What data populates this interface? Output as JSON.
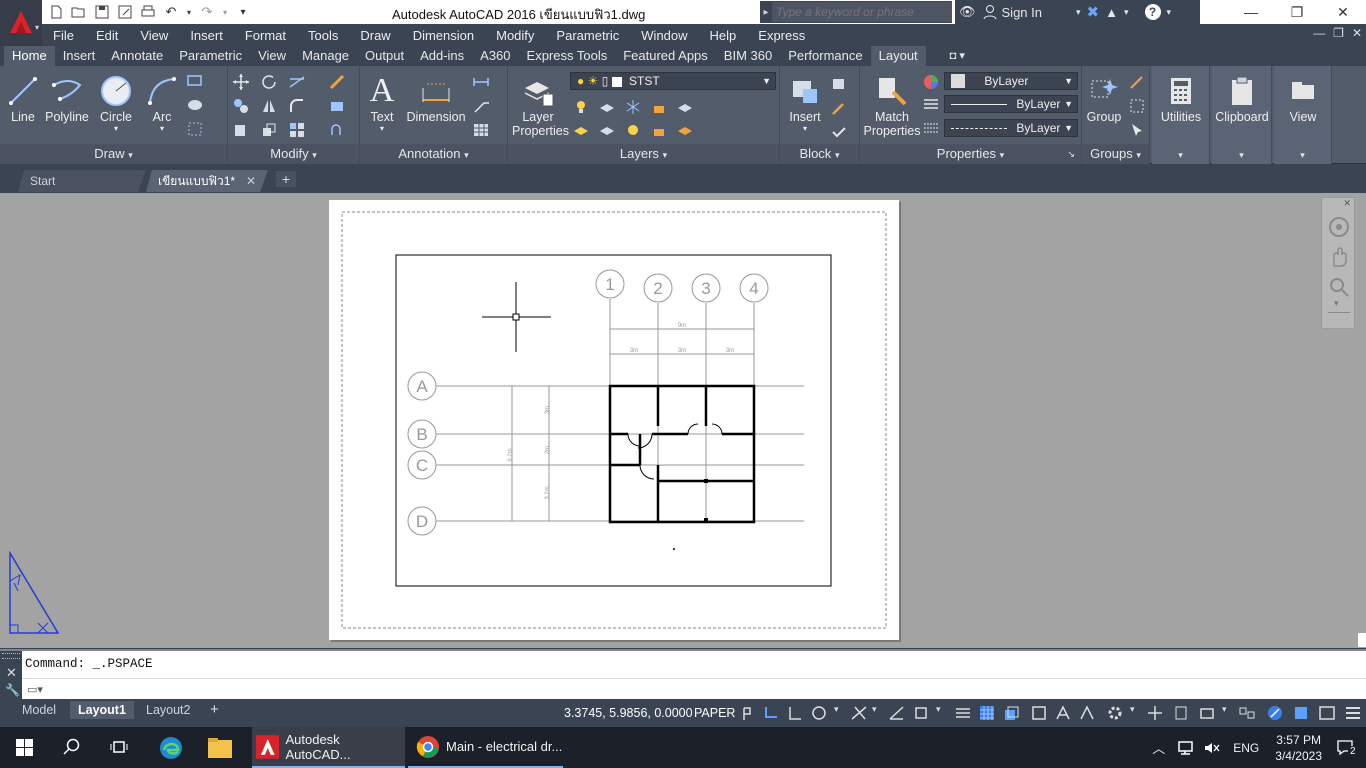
{
  "titlebar": {
    "app_title": "Autodesk AutoCAD 2016    เขียนแบบฟิว1.dwg",
    "search_placeholder": "Type a keyword or phrase",
    "signin_label": "Sign In",
    "qat_icons": [
      "new-icon",
      "open-icon",
      "save-icon",
      "saveas-icon",
      "plot-icon",
      "undo-icon",
      "redo-icon",
      "customize-icon"
    ]
  },
  "menu": [
    "File",
    "Edit",
    "View",
    "Insert",
    "Format",
    "Tools",
    "Draw",
    "Dimension",
    "Modify",
    "Parametric",
    "Window",
    "Help",
    "Express"
  ],
  "ribbon_tabs": [
    "Home",
    "Insert",
    "Annotate",
    "Parametric",
    "View",
    "Manage",
    "Output",
    "Add-ins",
    "A360",
    "Express Tools",
    "Featured Apps",
    "BIM 360",
    "Performance",
    "Layout"
  ],
  "ribbon": {
    "draw": {
      "title": "Draw",
      "tools": [
        "Line",
        "Polyline",
        "Circle",
        "Arc"
      ]
    },
    "modify": {
      "title": "Modify"
    },
    "annotation": {
      "title": "Annotation",
      "tools": [
        "Text",
        "Dimension"
      ]
    },
    "layers": {
      "title": "Layers",
      "tool_line1": "Layer",
      "tool_line2": "Properties",
      "current_layer": "STST"
    },
    "block": {
      "title": "Block",
      "tool": "Insert"
    },
    "properties": {
      "title": "Properties",
      "tool_line1": "Match",
      "tool_line2": "Properties",
      "color": "ByLayer",
      "linetype": "ByLayer",
      "lineweight": "ByLayer"
    },
    "groups": {
      "title": "Groups",
      "tool": "Group"
    },
    "utilities": {
      "tool": "Utilities"
    },
    "clipboard": {
      "tool": "Clipboard"
    },
    "view": {
      "tool": "View"
    }
  },
  "file_tabs": {
    "start": "Start",
    "drawing": "เขียนแบบฟิว1*"
  },
  "drawing": {
    "col_labels": [
      "1",
      "2",
      "3",
      "4"
    ],
    "row_labels": [
      "A",
      "B",
      "C",
      "D"
    ],
    "dim_total": "9m",
    "dim_spans": [
      "3m",
      "3m",
      "3m"
    ],
    "dim_vertical_total": "9.2m",
    "dim_vertical_spans": [
      "3m",
      "2m",
      "3.2m"
    ]
  },
  "command": {
    "history": "Command:  _.PSPACE",
    "input": ""
  },
  "layout_tabs": [
    "Model",
    "Layout1",
    "Layout2"
  ],
  "status": {
    "coordinates": "3.3745, 5.9856, 0.0000",
    "space": "PAPER"
  },
  "taskbar": {
    "apps": [
      "Autodesk AutoCAD...",
      "Main - electrical dr..."
    ],
    "language": "ENG",
    "time": "3:57 PM",
    "date": "3/4/2023",
    "notification_count": "2"
  },
  "colors": {
    "ribbon": "#535c6b",
    "chrome": "#3b4453",
    "canvas": "#a3a3a3",
    "autocad_red": "#d8232a",
    "ucs_blue": "#1f3fd8"
  }
}
